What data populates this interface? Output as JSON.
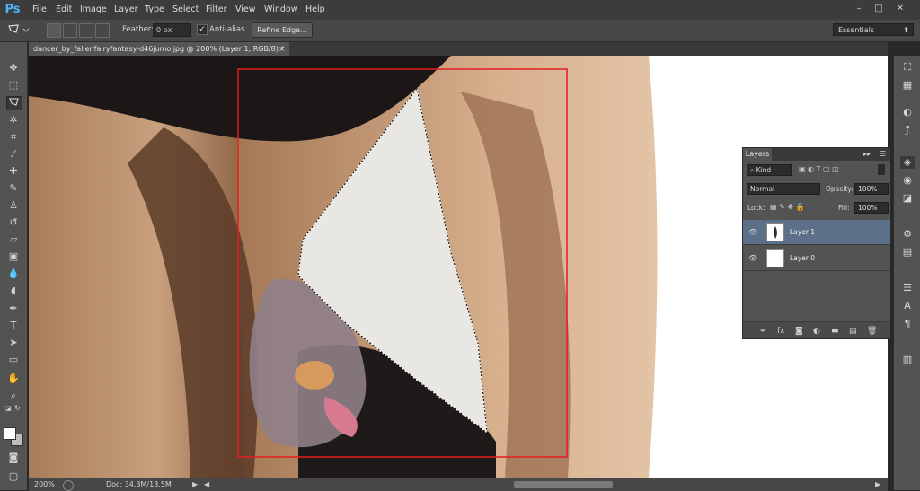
{
  "app": {
    "logo": "Ps"
  },
  "menu": [
    "File",
    "Edit",
    "Image",
    "Layer",
    "Type",
    "Select",
    "Filter",
    "View",
    "Window",
    "Help"
  ],
  "window_controls": {
    "minimize": "–",
    "maximize": "□",
    "close": "✕"
  },
  "options": {
    "feather_label": "Feather:",
    "feather_value": "0 px",
    "antialias_label": "Anti-alias",
    "antialias_checked": "✓",
    "refine_label": "Refine Edge...",
    "workspace": "Essentials"
  },
  "document": {
    "tab_title": "dancer_by_fallenfairyfantasy-d46jumo.jpg @ 200% (Layer 1, RGB/8) *",
    "tab_close": "×"
  },
  "status": {
    "zoom": "200%",
    "doc_size": "Doc: 34.3M/13.5M"
  },
  "layers_panel": {
    "title": "Layers",
    "filter_kind": "Kind",
    "blend_mode": "Normal",
    "opacity_label": "Opacity:",
    "opacity_value": "100%",
    "lock_label": "Lock:",
    "fill_label": "Fill:",
    "fill_value": "100%",
    "layers": [
      {
        "name": "Layer 1",
        "selected": true
      },
      {
        "name": "Layer 0",
        "selected": false
      }
    ]
  },
  "colors": {
    "selection_rect": "#e41e1e",
    "selected_layer": "#5d7089",
    "accent": "#4fb4ff"
  }
}
